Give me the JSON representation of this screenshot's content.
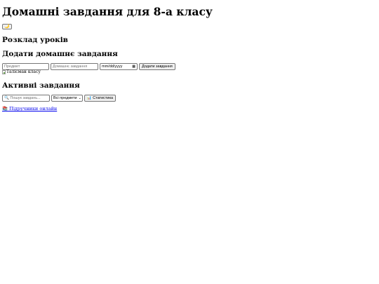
{
  "header": {
    "title": "Домашні завдання для 8-а класу",
    "theme_toggle_icon": "🌙"
  },
  "sections": {
    "schedule_title": "Розклад уроків",
    "add_title": "Додати домашнє завдання",
    "active_title": "Активні завдання"
  },
  "add_form": {
    "subject_placeholder": "Предмет",
    "task_placeholder": "Домашнє завдання",
    "date_value": "mm/dd/yyyy",
    "submit_label": "Додати завдання"
  },
  "mascot": {
    "alt": "Талісман класу"
  },
  "filters": {
    "search_placeholder": "🔍 Пошук завдань...",
    "subject_select_value": "Всі предмети",
    "stats_label": "📊 Статистика"
  },
  "links": {
    "textbooks": "📚 Підручники онлайн"
  }
}
